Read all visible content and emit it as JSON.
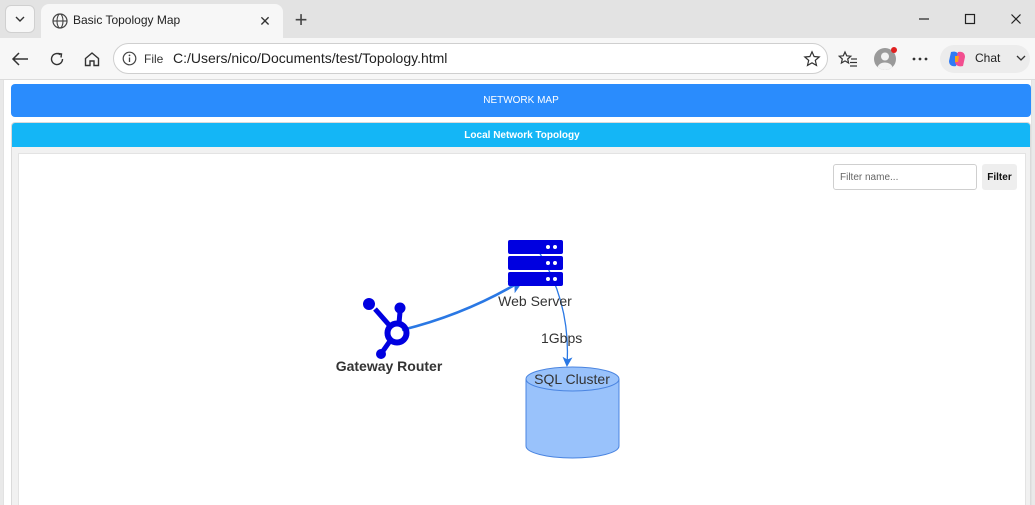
{
  "browser": {
    "tab_title": "Basic Topology Map",
    "file_label": "File",
    "url": "C:/Users/nico/Documents/test/Topology.html",
    "chat_label": "Chat"
  },
  "page": {
    "banner": "NETWORK MAP",
    "panel_title": "Local Network Topology",
    "filter": {
      "placeholder": "Filter name...",
      "button_label": "Filter"
    }
  },
  "topology": {
    "nodes": [
      {
        "id": "router",
        "label": "Gateway Router",
        "icon": "hub-icon",
        "color": "#0000e0"
      },
      {
        "id": "web",
        "label": "Web Server",
        "icon": "server-icon",
        "color": "#0000e0"
      },
      {
        "id": "sql",
        "label": "SQL Cluster",
        "icon": "database-cylinder",
        "color": "#99c2fb"
      }
    ],
    "edges": [
      {
        "from": "router",
        "to": "web",
        "label": "",
        "color": "#2a78e4"
      },
      {
        "from": "web",
        "to": "sql",
        "label": "1Gbps",
        "color": "#2a78e4"
      }
    ]
  },
  "colors": {
    "banner": "#2a8cfd",
    "panel_header": "#14b6f6",
    "edge": "#2a78e4"
  }
}
